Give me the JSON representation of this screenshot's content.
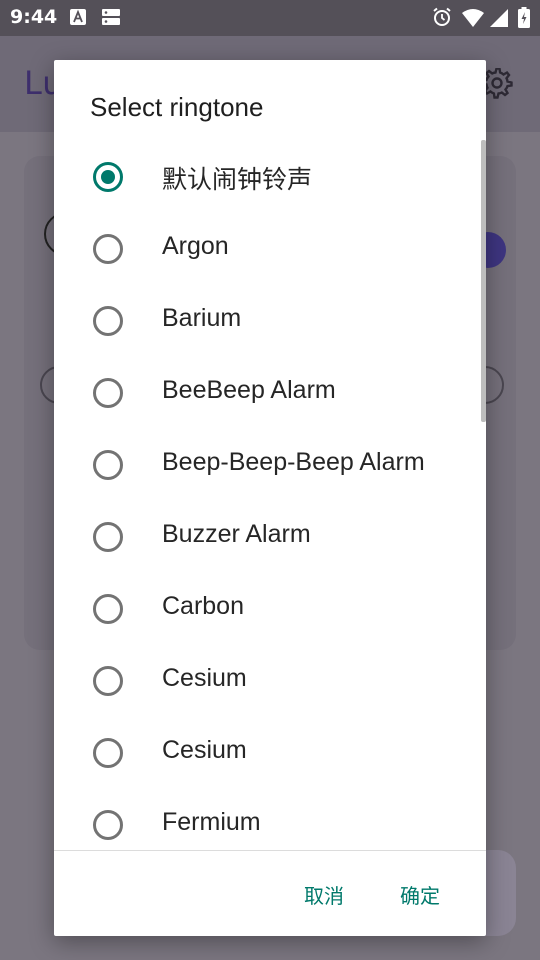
{
  "status_bar": {
    "time": "9:44"
  },
  "background_app": {
    "title": "Lu"
  },
  "dialog": {
    "title": "Select ringtone",
    "selected_index": 0,
    "items": [
      {
        "label": "默认闹钟铃声",
        "checked": true
      },
      {
        "label": "Argon",
        "checked": false
      },
      {
        "label": "Barium",
        "checked": false
      },
      {
        "label": "BeeBeep Alarm",
        "checked": false
      },
      {
        "label": "Beep-Beep-Beep Alarm",
        "checked": false
      },
      {
        "label": "Buzzer Alarm",
        "checked": false
      },
      {
        "label": "Carbon",
        "checked": false
      },
      {
        "label": "Cesium",
        "checked": false
      },
      {
        "label": "Cesium",
        "checked": false
      },
      {
        "label": "Fermium",
        "checked": false
      }
    ],
    "cancel_label": "取消",
    "ok_label": "确定"
  },
  "colors": {
    "accent": "#00796b",
    "scrim": "#7b7680"
  }
}
